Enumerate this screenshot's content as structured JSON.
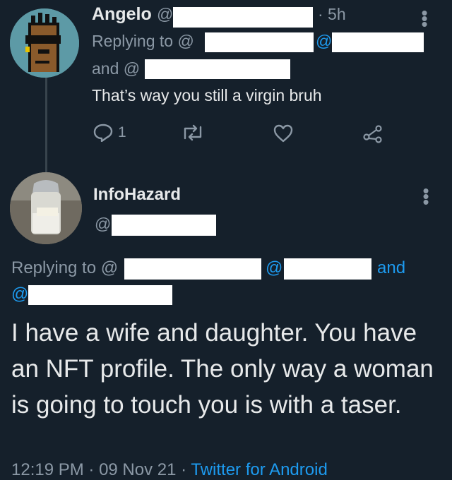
{
  "reply_tweet": {
    "author_name": "Angelo",
    "handle_prefix": "@",
    "time": "· 5h",
    "replying_to": "Replying to @",
    "second_at": "@",
    "and_at": "and @",
    "text": "That’s way you still a virgin bruh",
    "reply_count": "1"
  },
  "main_tweet": {
    "author_name": "InfoHazard",
    "handle_prefix": "@",
    "replying_to": "Replying to @",
    "second_at": "@",
    "and_label": "and",
    "third_at": "@",
    "text": "I have a wife and daughter. You have an NFT profile. The only way a woman is going to touch you is with a taser.",
    "time": "12:19 PM",
    "date": "09 Nov 21",
    "source": "Twitter for Android",
    "dot_sep": " · "
  },
  "colors": {
    "background": "#15202b",
    "link": "#1d9bf0",
    "muted": "#8b98a5"
  }
}
